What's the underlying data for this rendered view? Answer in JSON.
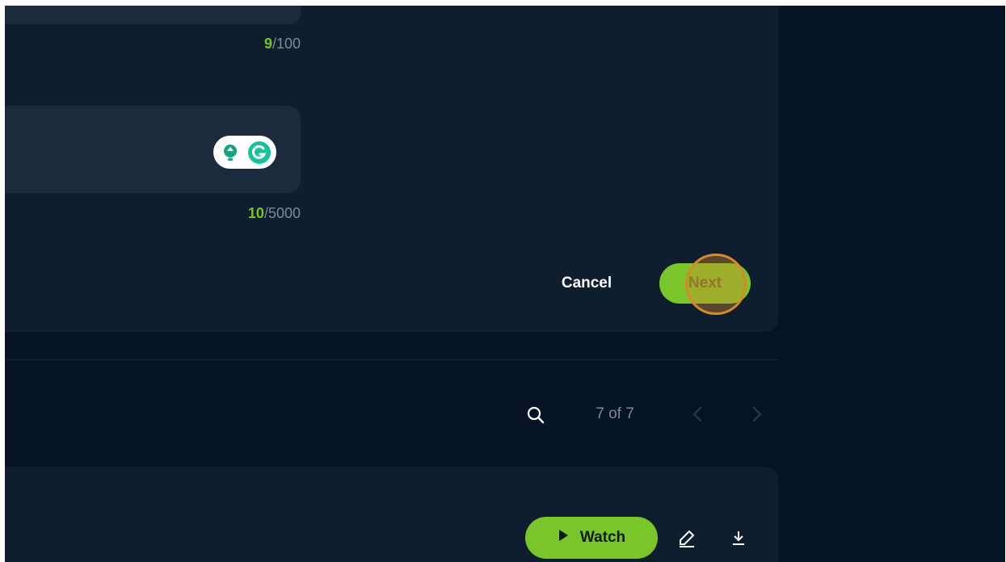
{
  "form": {
    "title_counter": {
      "used": "9",
      "max": "/100"
    },
    "description_counter": {
      "used": "10",
      "max": "/5000"
    },
    "extension_icons": [
      "lightbulb-icon",
      "grammarly-icon"
    ],
    "cancel_label": "Cancel",
    "next_label": "Next"
  },
  "list_toolbar": {
    "search_icon": "search-icon",
    "pager_text": "7 of 7",
    "prev_icon": "chevron-left-icon",
    "next_icon": "chevron-right-icon"
  },
  "card": {
    "watch_label": "Watch",
    "watch_icon": "play-icon",
    "edit_icon": "pencil-icon",
    "download_icon": "download-icon"
  },
  "colors": {
    "background": "#061325",
    "panel": "#0f1e2f",
    "field": "#1b2a3c",
    "accent": "#7ac62a",
    "counter_highlight": "#76c51e",
    "muted_text": "#7d8a99",
    "click_highlight": "#d48a2a"
  }
}
